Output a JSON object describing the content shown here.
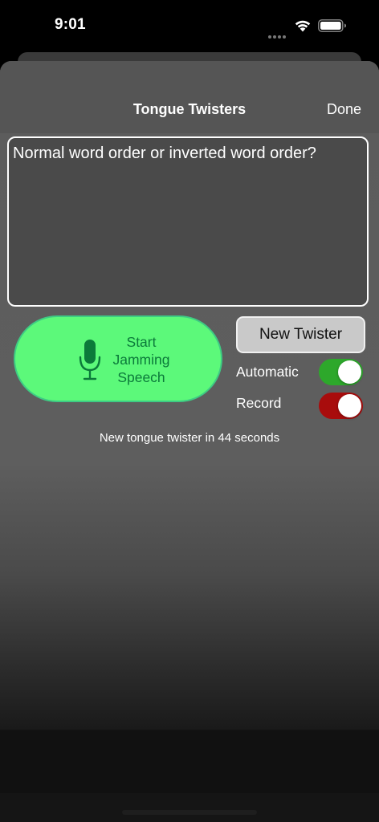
{
  "status_bar": {
    "time": "9:01"
  },
  "nav": {
    "title": "Tongue Twisters",
    "done_label": "Done"
  },
  "twister_text": "Normal word order or inverted word order?",
  "mic_button": {
    "line1": "Start",
    "line2": "Jamming",
    "line3": "Speech",
    "icon": "microphone-icon"
  },
  "new_twister_label": "New Twister",
  "toggles": {
    "automatic": {
      "label": "Automatic",
      "on": true,
      "color": "#2da82b"
    },
    "record": {
      "label": "Record",
      "on": true,
      "color": "#a80c0c"
    }
  },
  "countdown_text": "New tongue twister in 44 seconds",
  "colors": {
    "mic_button_bg": "#5cf97a",
    "mic_text": "#0b7a3a"
  }
}
